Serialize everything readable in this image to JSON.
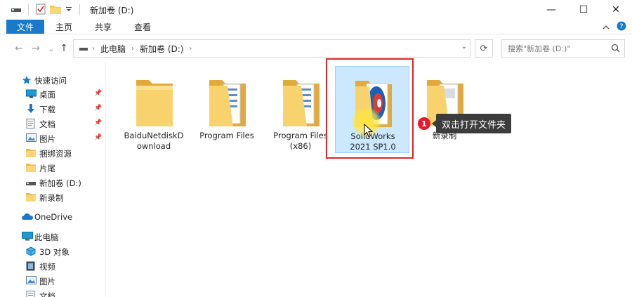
{
  "window": {
    "title": "新加卷 (D:)",
    "controls": {
      "minimize": "—",
      "maximize": "☐",
      "close": "✕"
    }
  },
  "ribbon": {
    "tabs": [
      "文件",
      "主页",
      "共享",
      "查看"
    ]
  },
  "nav": {
    "back": "←",
    "forward": "→",
    "recent": "⌄",
    "up": "↑"
  },
  "address": {
    "crumbs": [
      "此电脑",
      "新加卷 (D:)"
    ]
  },
  "search": {
    "placeholder": "搜索\"新加卷 (D:)\""
  },
  "sidebar": {
    "quick_access": "快速访问",
    "items": [
      {
        "label": "桌面",
        "icon": "desktop-icon",
        "pinned": true
      },
      {
        "label": "下载",
        "icon": "download-icon",
        "pinned": true
      },
      {
        "label": "文档",
        "icon": "document-icon",
        "pinned": true
      },
      {
        "label": "图片",
        "icon": "picture-icon",
        "pinned": true
      },
      {
        "label": "捆绑资源",
        "icon": "folder-icon",
        "pinned": false
      },
      {
        "label": "片尾",
        "icon": "folder-icon",
        "pinned": false
      },
      {
        "label": "新加卷 (D:)",
        "icon": "drive-icon",
        "pinned": false
      },
      {
        "label": "新录制",
        "icon": "folder-icon",
        "pinned": false
      }
    ],
    "onedrive": "OneDrive",
    "this_pc": "此电脑",
    "pc_items": [
      {
        "label": "3D 对象",
        "icon": "3d-objects-icon"
      },
      {
        "label": "视频",
        "icon": "video-icon"
      },
      {
        "label": "图片",
        "icon": "picture-icon"
      },
      {
        "label": "文档",
        "icon": "document-icon"
      }
    ]
  },
  "files": [
    {
      "line1": "BaiduNetdiskD",
      "line2": "ownload"
    },
    {
      "line1": "Program Files",
      "line2": ""
    },
    {
      "line1": "Program Files",
      "line2": "(x86)"
    },
    {
      "line1": "SolidWorks",
      "line2": "2021 SP1.0"
    },
    {
      "line1": "新录制",
      "line2": ""
    }
  ],
  "annotation": {
    "step": "1",
    "text": "双击打开文件夹"
  },
  "colors": {
    "accent": "#1979ca",
    "selection_bg": "#cce8ff",
    "highlight_box": "#e02424",
    "badge": "#e8192c",
    "folder": "#f5c85c"
  }
}
